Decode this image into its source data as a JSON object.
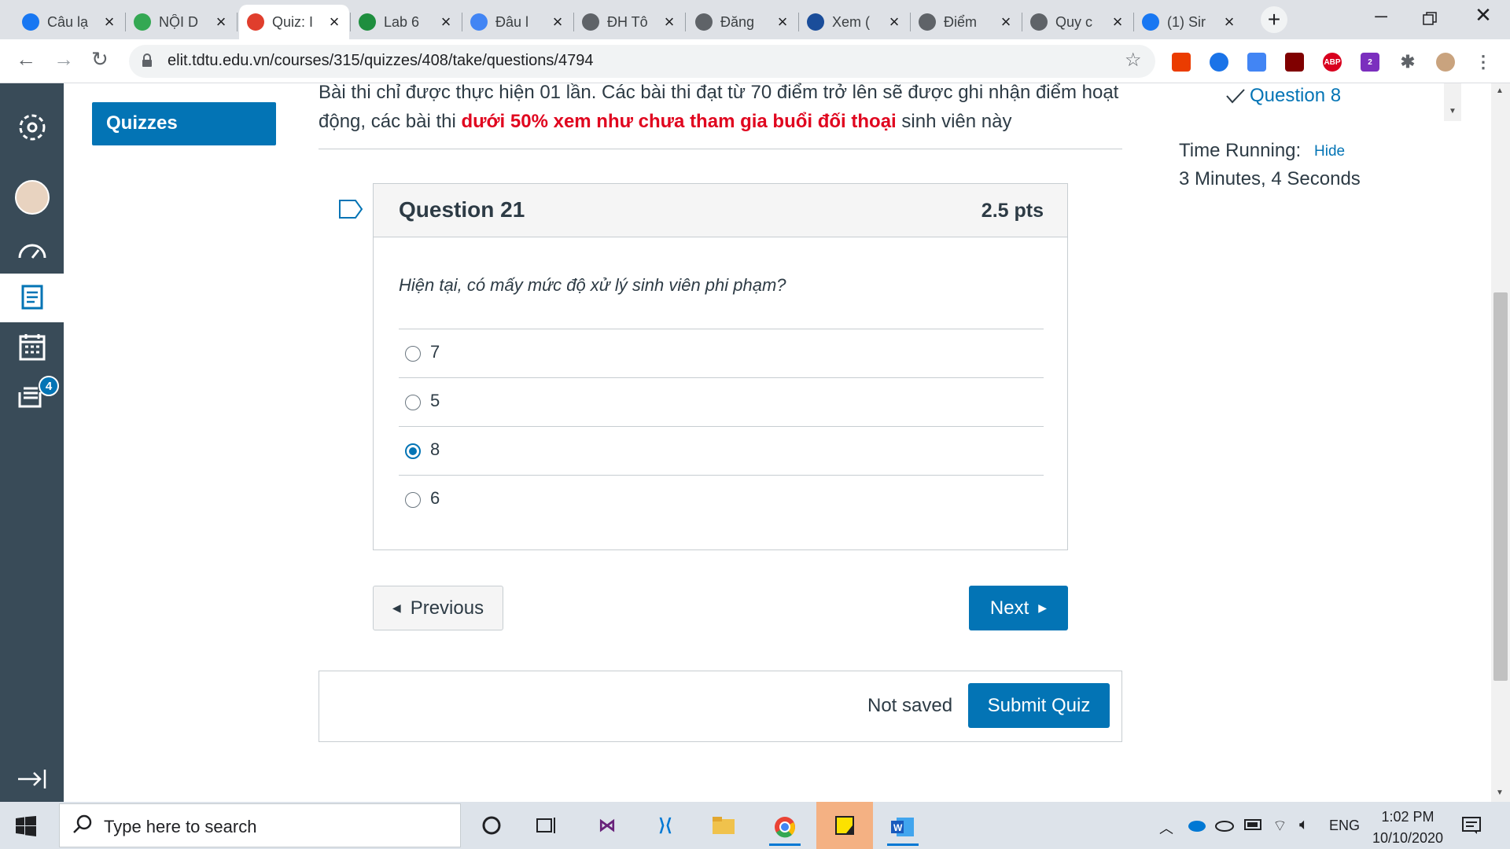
{
  "browser": {
    "tabs": [
      {
        "title": "Câu lạ",
        "icon": "facebook-icon"
      },
      {
        "title": "NỘI D",
        "icon": "google-drive-icon"
      },
      {
        "title": "Quiz: I",
        "icon": "canvas-icon",
        "active": true
      },
      {
        "title": "Lab 6",
        "icon": "classroom-icon"
      },
      {
        "title": "Đâu l",
        "icon": "google-icon"
      },
      {
        "title": "ĐH Tô",
        "icon": "globe-icon"
      },
      {
        "title": "Đăng",
        "icon": "globe-icon"
      },
      {
        "title": "Xem (",
        "icon": "tdt-icon"
      },
      {
        "title": "Điểm",
        "icon": "globe-icon"
      },
      {
        "title": "Quy c",
        "icon": "globe-icon"
      },
      {
        "title": "(1) Sir",
        "icon": "facebook-icon"
      }
    ],
    "url": "elit.tdtu.edu.vn/courses/315/quizzes/408/take/questions/4794",
    "extensions": [
      "ABP",
      "2"
    ]
  },
  "course_nav": {
    "quizzes_label": "Quizzes",
    "inbox_badge": "4"
  },
  "instructions": {
    "line_part1": "Bài thi chỉ được thực hiện 01 lần. Các bài thi đạt từ 70 điểm trở lên sẽ được ghi nhận điểm hoạt động, các bài thi ",
    "highlight": "dưới 50% xem như chưa tham gia buổi đối thoại",
    "line_part2": " sinh viên này"
  },
  "question": {
    "title": "Question 21",
    "points": "2.5 pts",
    "text": "Hiện tại, có mấy mức độ xử lý sinh viên phi phạm?",
    "answers": [
      {
        "label": "7",
        "selected": false
      },
      {
        "label": "5",
        "selected": false
      },
      {
        "label": "8",
        "selected": true
      },
      {
        "label": "6",
        "selected": false
      }
    ]
  },
  "nav_buttons": {
    "previous": "Previous",
    "next": "Next"
  },
  "submit": {
    "status": "Not saved",
    "label": "Submit Quiz"
  },
  "sidebar": {
    "question_link": "Question 8",
    "time_label": "Time Running:",
    "hide_label": "Hide",
    "time_value": "3 Minutes, 4 Seconds"
  },
  "taskbar": {
    "search_placeholder": "Type here to search",
    "language": "ENG",
    "time": "1:02 PM",
    "date": "10/10/2020"
  },
  "colors": {
    "primary": "#0374b5",
    "warning": "#e0061f",
    "nav_bg": "#394b58"
  }
}
